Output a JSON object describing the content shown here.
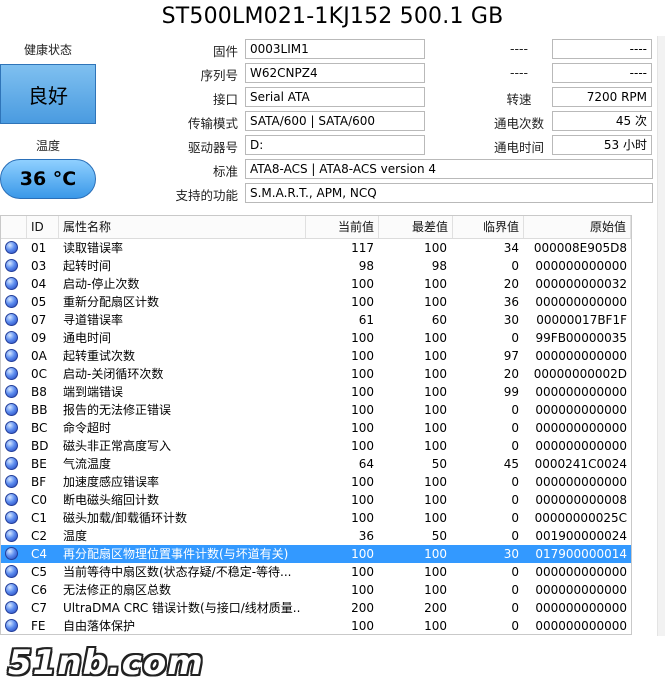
{
  "title": "ST500LM021-1KJ152 500.1 GB",
  "health": {
    "label": "健康状态",
    "value": "良好"
  },
  "temperature": {
    "label": "温度",
    "value": "36 °C"
  },
  "info": {
    "firmware": {
      "label": "固件",
      "value": "0003LIM1"
    },
    "serial": {
      "label": "序列号",
      "value": "W62CNPZ4"
    },
    "interface": {
      "label": "接口",
      "value": "Serial ATA"
    },
    "transfer_mode": {
      "label": "传输模式",
      "value": "SATA/600 | SATA/600"
    },
    "drive_letter": {
      "label": "驱动器号",
      "value": "D:"
    },
    "standard": {
      "label": "标准",
      "value": "ATA8-ACS | ATA8-ACS version 4"
    },
    "features": {
      "label": "支持的功能",
      "value": "S.M.A.R.T., APM, NCQ"
    }
  },
  "right_info": {
    "r1": {
      "label": "----",
      "value": "----"
    },
    "r2": {
      "label": "----",
      "value": "----"
    },
    "rotation": {
      "label": "转速",
      "value": "7200 RPM"
    },
    "power_count": {
      "label": "通电次数",
      "value": "45 次"
    },
    "power_hours": {
      "label": "通电时间",
      "value": "53 小时"
    }
  },
  "table": {
    "headers": {
      "id": "ID",
      "name": "属性名称",
      "current": "当前值",
      "worst": "最差值",
      "threshold": "临界值",
      "raw": "原始值"
    },
    "rows": [
      {
        "id": "01",
        "name": "读取错误率",
        "current": "117",
        "worst": "100",
        "threshold": "34",
        "raw": "000008E905D8"
      },
      {
        "id": "03",
        "name": "起转时间",
        "current": "98",
        "worst": "98",
        "threshold": "0",
        "raw": "000000000000"
      },
      {
        "id": "04",
        "name": "启动-停止次数",
        "current": "100",
        "worst": "100",
        "threshold": "20",
        "raw": "000000000032"
      },
      {
        "id": "05",
        "name": "重新分配扇区计数",
        "current": "100",
        "worst": "100",
        "threshold": "36",
        "raw": "000000000000"
      },
      {
        "id": "07",
        "name": "寻道错误率",
        "current": "61",
        "worst": "60",
        "threshold": "30",
        "raw": "00000017BF1F"
      },
      {
        "id": "09",
        "name": "通电时间",
        "current": "100",
        "worst": "100",
        "threshold": "0",
        "raw": "99FB00000035"
      },
      {
        "id": "0A",
        "name": "起转重试次数",
        "current": "100",
        "worst": "100",
        "threshold": "97",
        "raw": "000000000000"
      },
      {
        "id": "0C",
        "name": "启动-关闭循环次数",
        "current": "100",
        "worst": "100",
        "threshold": "20",
        "raw": "00000000002D"
      },
      {
        "id": "B8",
        "name": "端到端错误",
        "current": "100",
        "worst": "100",
        "threshold": "99",
        "raw": "000000000000"
      },
      {
        "id": "BB",
        "name": "报告的无法修正错误",
        "current": "100",
        "worst": "100",
        "threshold": "0",
        "raw": "000000000000"
      },
      {
        "id": "BC",
        "name": "命令超时",
        "current": "100",
        "worst": "100",
        "threshold": "0",
        "raw": "000000000000"
      },
      {
        "id": "BD",
        "name": "磁头非正常高度写入",
        "current": "100",
        "worst": "100",
        "threshold": "0",
        "raw": "000000000000"
      },
      {
        "id": "BE",
        "name": "气流温度",
        "current": "64",
        "worst": "50",
        "threshold": "45",
        "raw": "0000241C0024"
      },
      {
        "id": "BF",
        "name": "加速度感应错误率",
        "current": "100",
        "worst": "100",
        "threshold": "0",
        "raw": "000000000000"
      },
      {
        "id": "C0",
        "name": "断电磁头缩回计数",
        "current": "100",
        "worst": "100",
        "threshold": "0",
        "raw": "000000000008"
      },
      {
        "id": "C1",
        "name": "磁头加载/卸载循环计数",
        "current": "100",
        "worst": "100",
        "threshold": "0",
        "raw": "00000000025C"
      },
      {
        "id": "C2",
        "name": "温度",
        "current": "36",
        "worst": "50",
        "threshold": "0",
        "raw": "001900000024"
      },
      {
        "id": "C4",
        "name": "再分配扇区物理位置事件计数(与坏道有关)",
        "current": "100",
        "worst": "100",
        "threshold": "30",
        "raw": "017900000014",
        "selected": true
      },
      {
        "id": "C5",
        "name": "当前等待中扇区数(状态存疑/不稳定-等待...",
        "current": "100",
        "worst": "100",
        "threshold": "0",
        "raw": "000000000000"
      },
      {
        "id": "C6",
        "name": "无法修正的扇区总数",
        "current": "100",
        "worst": "100",
        "threshold": "0",
        "raw": "000000000000"
      },
      {
        "id": "C7",
        "name": "UltraDMA CRC 错误计数(与接口/线材质量...",
        "current": "200",
        "worst": "200",
        "threshold": "0",
        "raw": "000000000000"
      },
      {
        "id": "FE",
        "name": "自由落体保护",
        "current": "100",
        "worst": "100",
        "threshold": "0",
        "raw": "000000000000"
      }
    ]
  },
  "watermark": "51nb.com",
  "colors": {
    "health_bg": "#5aa8e8",
    "temp_bg": "#4aa3f0",
    "selected_row": "#3399ff"
  }
}
